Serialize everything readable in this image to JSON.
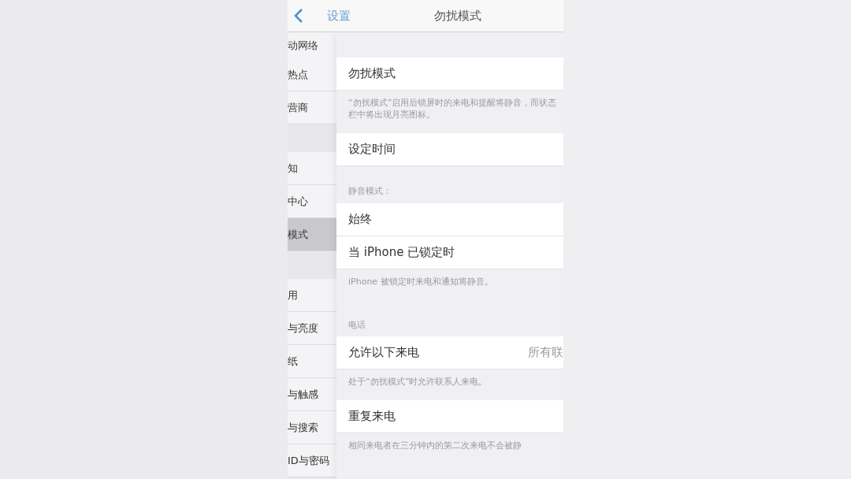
{
  "nav": {
    "back": "设置",
    "title": "勿扰模式"
  },
  "behind_list": [
    {
      "label": "动网络",
      "kind": "header"
    },
    {
      "label": "热点",
      "kind": "row",
      "selected": false
    },
    {
      "label": "营商",
      "kind": "row",
      "selected": false
    },
    {
      "kind": "gap"
    },
    {
      "label": "知",
      "kind": "row",
      "selected": false
    },
    {
      "label": "中心",
      "kind": "row",
      "selected": false
    },
    {
      "label": "模式",
      "kind": "row",
      "selected": true
    },
    {
      "kind": "gap"
    },
    {
      "label": "用",
      "kind": "row",
      "selected": false
    },
    {
      "label": "与亮度",
      "kind": "row",
      "selected": false
    },
    {
      "label": "纸",
      "kind": "row",
      "selected": false
    },
    {
      "label": "与触感",
      "kind": "row",
      "selected": false
    },
    {
      "label": "与搜索",
      "kind": "row",
      "selected": false
    },
    {
      "label": "ID与密码",
      "kind": "row",
      "selected": false
    }
  ],
  "page": [
    {
      "kind": "row",
      "label": "勿扰模式"
    },
    {
      "kind": "footnote",
      "label": "“勿扰模式”启用后锁屏时的来电和提醒将静音，而状态栏中将出现月亮图标。"
    },
    {
      "kind": "row",
      "label": "设定时间"
    },
    {
      "kind": "header",
      "label": "静音模式："
    },
    {
      "kind": "row",
      "label": "始终"
    },
    {
      "kind": "row",
      "label": "当 iPhone 已锁定时"
    },
    {
      "kind": "footnote",
      "label": "iPhone 被锁定时来电和通知将静音。"
    },
    {
      "kind": "header",
      "label": "电话"
    },
    {
      "kind": "row",
      "label": "允许以下来电",
      "value": "所有联"
    },
    {
      "kind": "footnote",
      "label": "处于“勿扰模式”时允许联系人来电。"
    },
    {
      "kind": "row",
      "label": "重复来电"
    },
    {
      "kind": "footnote",
      "label": "相同来电者在三分钟内的第二次来电不会被静"
    }
  ]
}
